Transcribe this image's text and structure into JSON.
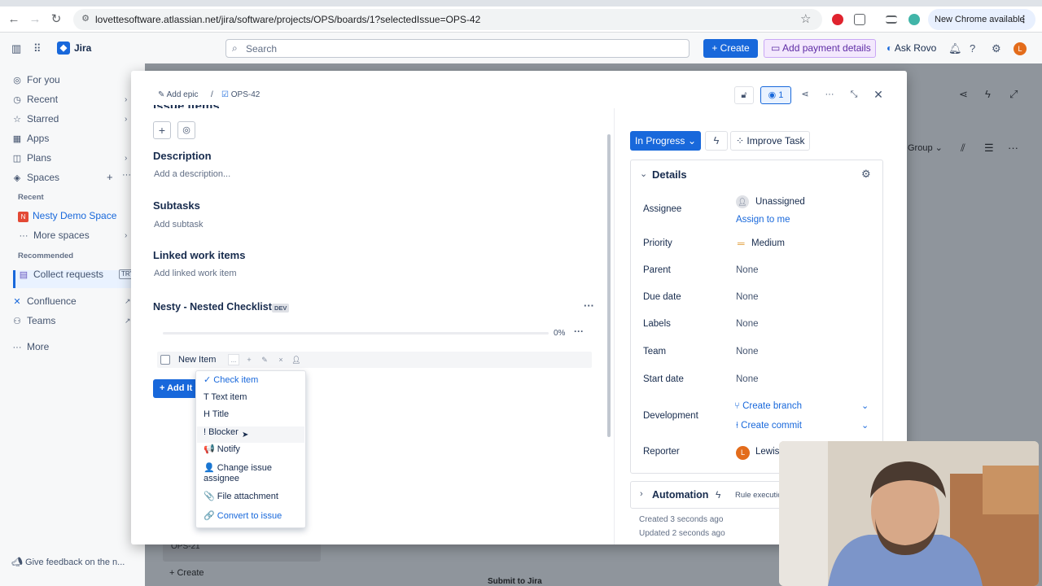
{
  "browser": {
    "url": "lovettesoftware.atlassian.net/jira/software/projects/OPS/boards/1?selectedIssue=OPS-42",
    "new_chrome": "New Chrome available"
  },
  "topnav": {
    "app_name": "Jira",
    "search_placeholder": "Search",
    "create_label": "+ Create",
    "payment_label": "Add payment details",
    "rovo_label": "Ask Rovo",
    "avatar_initial": "L"
  },
  "sidebar": {
    "items": [
      {
        "label": "For you",
        "icon": "user-circle-icon"
      },
      {
        "label": "Recent",
        "icon": "clock-icon"
      },
      {
        "label": "Starred",
        "icon": "star-icon"
      },
      {
        "label": "Apps",
        "icon": "apps-icon"
      },
      {
        "label": "Plans",
        "icon": "plans-icon"
      },
      {
        "label": "Spaces",
        "icon": "spaces-icon"
      }
    ],
    "recent_heading": "Recent",
    "active_space": "Nesty Demo Space",
    "more_spaces": "More spaces",
    "recommended_heading": "Recommended",
    "collect_requests": "Collect requests",
    "try_badge": "TRY",
    "confluence": "Confluence",
    "teams": "Teams",
    "more": "More",
    "feedback": "Give feedback on the n..."
  },
  "board": {
    "group_label": "Group",
    "card_key": "OPS-21",
    "create_label": "+ Create",
    "submit_label": "Submit to Jira"
  },
  "modal": {
    "breadcrumb_epic": "Add epic",
    "breadcrumb_sep": "/",
    "breadcrumb_issue": "OPS-42",
    "watch_count": "1",
    "partial_heading": "issue items",
    "description_title": "Description",
    "description_placeholder": "Add a description...",
    "subtasks_title": "Subtasks",
    "subtasks_placeholder": "Add subtask",
    "linked_title": "Linked work items",
    "linked_placeholder": "Add linked work item",
    "checklist_title": "Nesty - Nested Checklist",
    "dev_badge": "DEV",
    "progress_text": "0%",
    "progress_value": 0,
    "new_item_text": "New Item",
    "new_item_dots": "...",
    "add_item_label": "+ Add It",
    "dropdown": [
      {
        "label": "✓ Check item",
        "link": true
      },
      {
        "label": "T Text item",
        "link": false
      },
      {
        "label": "H Title",
        "link": false
      },
      {
        "label": "! Blocker",
        "link": false
      },
      {
        "label": "📢 Notify",
        "link": false
      },
      {
        "label": "👤 Change issue assignee",
        "link": false
      },
      {
        "label": "📎 File attachment",
        "link": false
      },
      {
        "label": "🔗 Convert to issue",
        "link": true
      }
    ],
    "status_label": "In Progress",
    "improve_label": "Improve Task",
    "details_title": "Details",
    "fields": {
      "assignee_label": "Assignee",
      "assignee_value": "Unassigned",
      "assign_to_me": "Assign to me",
      "priority_label": "Priority",
      "priority_value": "Medium",
      "parent_label": "Parent",
      "parent_value": "None",
      "due_label": "Due date",
      "due_value": "None",
      "labels_label": "Labels",
      "labels_value": "None",
      "team_label": "Team",
      "team_value": "None",
      "start_label": "Start date",
      "start_value": "None",
      "dev_label": "Development",
      "create_branch": "Create branch",
      "create_commit": "Create commit",
      "reporter_label": "Reporter",
      "reporter_value": "Lewis",
      "reporter_initial": "L"
    },
    "automation_title": "Automation",
    "automation_sub": "Rule executio",
    "created": "Created 3 seconds ago",
    "updated": "Updated 2 seconds ago"
  },
  "colors": {
    "brand": "#1868db",
    "priority_medium": "#e2a03f",
    "avatar": "#e36c1b"
  }
}
